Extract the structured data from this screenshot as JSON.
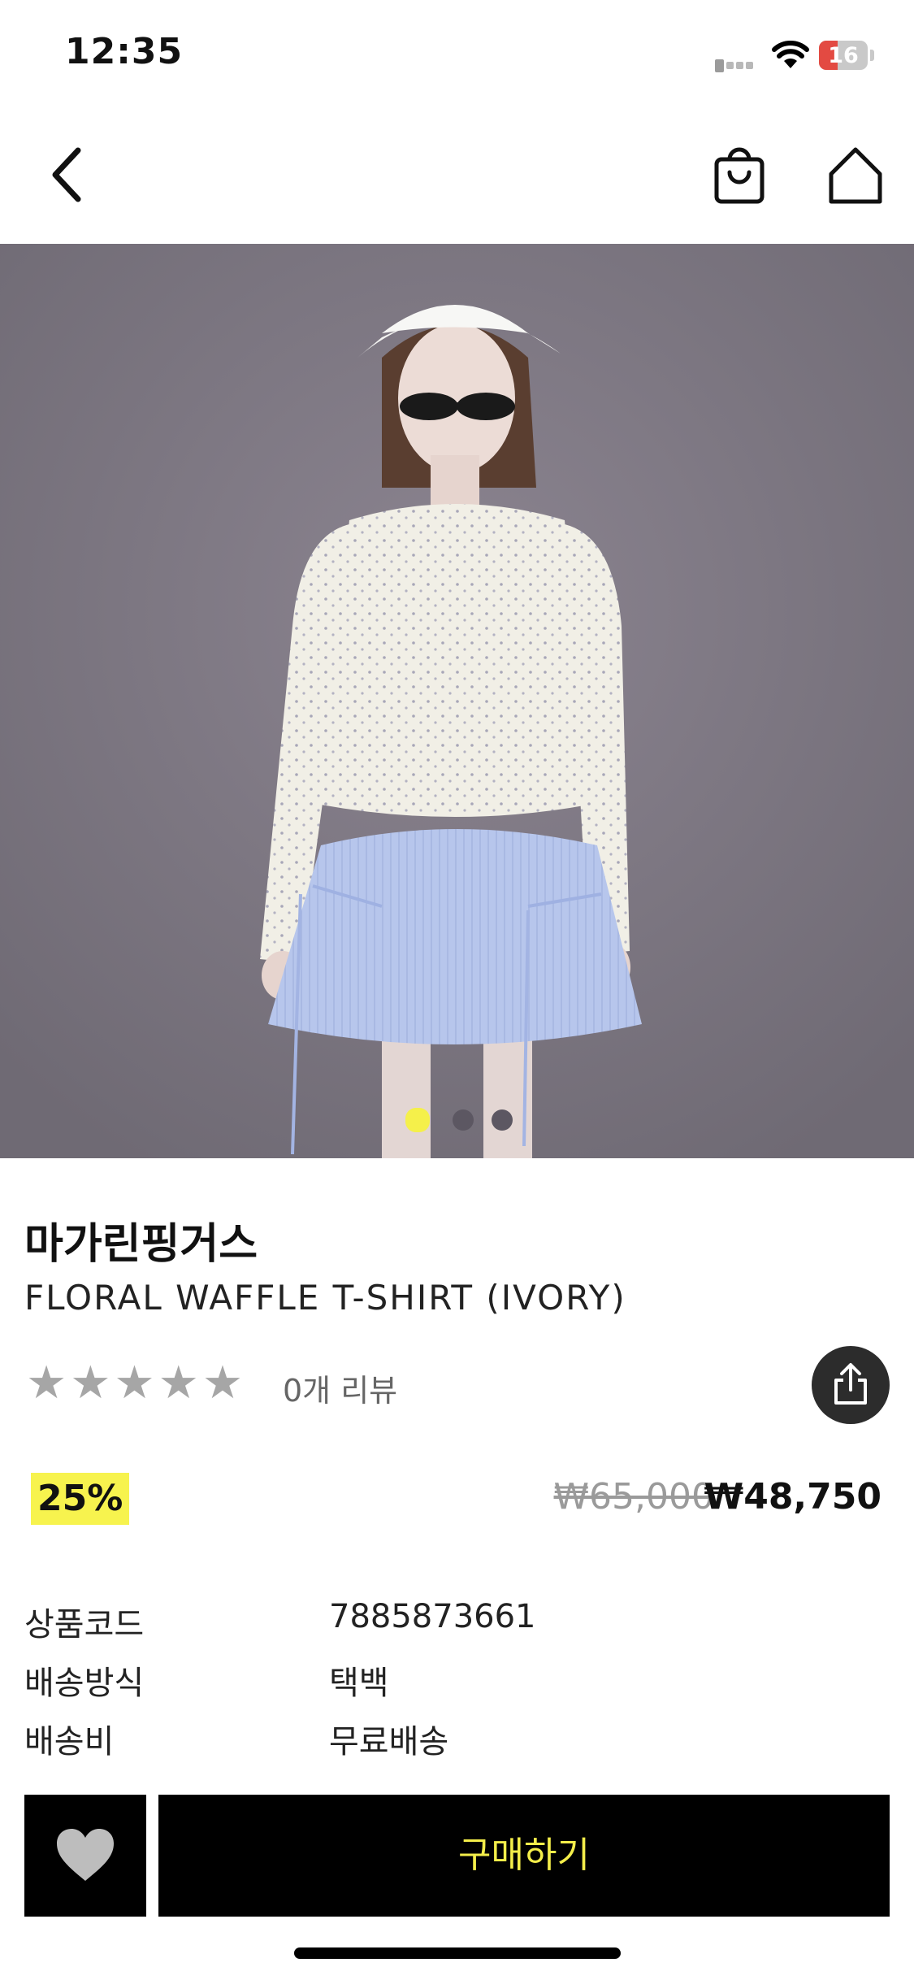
{
  "status_bar": {
    "time": "12:35",
    "battery": "16",
    "icons": [
      "signal-icon",
      "wifi-icon",
      "battery-icon"
    ]
  },
  "nav": {
    "icons": [
      "back-icon",
      "cart-icon",
      "home-icon"
    ]
  },
  "gallery": {
    "page_count": 3,
    "active_page": 1,
    "active_dot_color": "#f5f04a"
  },
  "product": {
    "brand": "마가린핑거스",
    "name": "FLORAL WAFFLE T-SHIRT (IVORY)",
    "rating_stars": 5,
    "review_count": "0개 리뷰",
    "discount": "25%",
    "price_original": "₩65,000",
    "price_sale": "₩48,750"
  },
  "specs": [
    {
      "label": "상품코드",
      "value": "7885873661"
    },
    {
      "label": "배송방식",
      "value": "택백"
    },
    {
      "label": "배송비",
      "value": "무료배송"
    }
  ],
  "actions": {
    "buy_label": "구매하기"
  },
  "colors": {
    "accent": "#f5f04a",
    "button_bg": "#000000"
  }
}
